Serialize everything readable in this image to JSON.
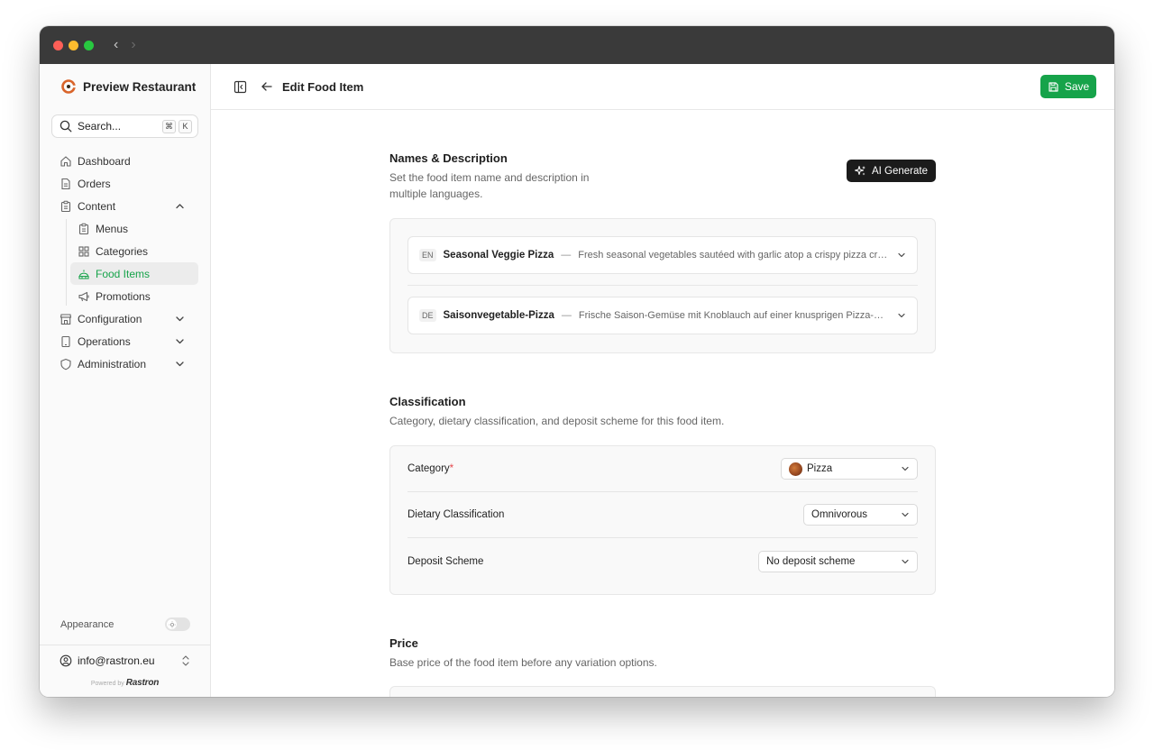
{
  "sidebar": {
    "brand": "Preview Restaurant",
    "search_label": "Search...",
    "search_keys": [
      "⌘",
      "K"
    ],
    "nav": {
      "dashboard": "Dashboard",
      "orders": "Orders",
      "content": "Content",
      "menus": "Menus",
      "categories": "Categories",
      "food_items": "Food Items",
      "promotions": "Promotions",
      "configuration": "Configuration",
      "operations": "Operations",
      "administration": "Administration"
    },
    "appearance": "Appearance",
    "email": "info@rastron.eu",
    "powered_by": "Powered by",
    "powered_brand": "Rastron"
  },
  "header": {
    "title": "Edit Food Item",
    "save": "Save"
  },
  "names": {
    "title": "Names & Description",
    "desc": "Set the food item name and description in multiple languages.",
    "ai_button": "AI Generate",
    "languages": [
      {
        "code": "EN",
        "name": "Seasonal Veggie Pizza",
        "desc": "Fresh seasonal vegetables sautéed with garlic atop a crispy pizza crust"
      },
      {
        "code": "DE",
        "name": "Saisonvegetable-Pizza",
        "desc": "Frische Saison-Gemüse mit Knoblauch auf einer knusprigen Pizza-Kruste"
      }
    ]
  },
  "classification": {
    "title": "Classification",
    "desc": "Category, dietary classification, and deposit scheme for this food item.",
    "category_label": "Category",
    "category_required": "*",
    "category_value": "Pizza",
    "dietary_label": "Dietary Classification",
    "dietary_value": "Omnivorous",
    "deposit_label": "Deposit Scheme",
    "deposit_value": "No deposit scheme"
  },
  "price": {
    "title": "Price",
    "desc": "Base price of the food item before any variation options."
  },
  "colors": {
    "accent": "#16a34a",
    "dark_button": "#1b1b1b",
    "required": "#e5484d"
  }
}
